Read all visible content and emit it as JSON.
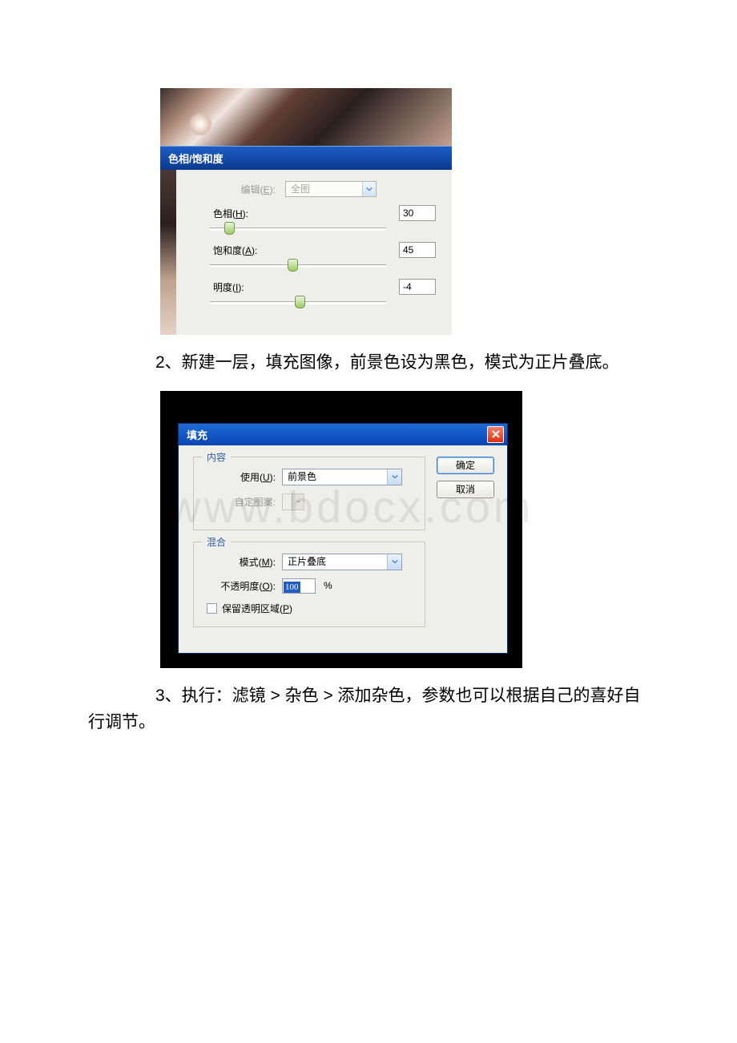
{
  "watermark": "www.bdocx.com",
  "dialog1": {
    "title": "色相/饱和度",
    "edit_label": "编辑(E):",
    "edit_value": "全图",
    "hue_label": "色相(H):",
    "hue_value": "30",
    "sat_label": "饱和度(A):",
    "sat_value": "45",
    "light_label": "明度(I):",
    "light_value": "-4"
  },
  "step2": "2、新建一层，填充图像，前景色设为黑色，模式为正片叠底。",
  "dialog2": {
    "title": "填充",
    "group_content": "内容",
    "use_label": "使用(U):",
    "use_value": "前景色",
    "pattern_label": "自定图案:",
    "group_blend": "混合",
    "mode_label": "模式(M):",
    "mode_value": "正片叠底",
    "opacity_label": "不透明度(O):",
    "opacity_value": "100",
    "opacity_pct": "%",
    "preserve_label": "保留透明区域(P)",
    "ok": "确定",
    "cancel": "取消"
  },
  "step3": "3、执行：滤镜 > 杂色 > 添加杂色，参数也可以根据自己的喜好自行调节。"
}
